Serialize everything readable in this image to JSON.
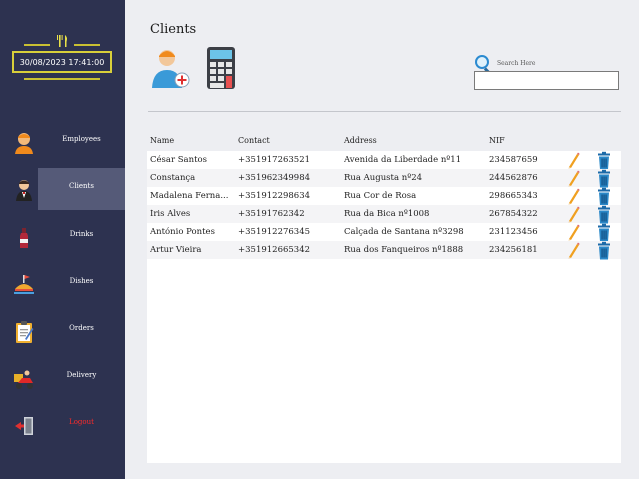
{
  "sidebar": {
    "clock": "30/08/2023 17:41:00",
    "items": [
      {
        "label": "Employees",
        "icon": "employee-icon"
      },
      {
        "label": "Clients",
        "icon": "waiter-icon"
      },
      {
        "label": "Drinks",
        "icon": "bottle-icon"
      },
      {
        "label": "Dishes",
        "icon": "dish-icon"
      },
      {
        "label": "Orders",
        "icon": "clipboard-icon"
      },
      {
        "label": "Delivery",
        "icon": "scooter-icon"
      },
      {
        "label": "Logout",
        "icon": "door-icon"
      }
    ]
  },
  "main": {
    "title": "Clients",
    "search": {
      "label": "Search Here",
      "value": ""
    },
    "table": {
      "headers": [
        "Name",
        "Contact",
        "Address",
        "NIF"
      ],
      "rows": [
        [
          "César Santos",
          "+351917263521",
          "Avenida da Liberdade nº11",
          "234587659"
        ],
        [
          "Constança",
          "+351962349984",
          "Rua Augusta nº24",
          "244562876"
        ],
        [
          "Madalena Ferna...",
          "+351912298634",
          "Rua Cor de Rosa",
          "298665343"
        ],
        [
          "Íris Alves",
          "+35191762342",
          "Rua da Bica nº1008",
          "267854322"
        ],
        [
          "António Pontes",
          "+351912276345",
          "Calçada de Santana nº3298",
          "231123456"
        ],
        [
          "Artur Vieira",
          "+351912665342",
          "Rua dos Fanqueiros nº1888",
          "234256181"
        ]
      ]
    }
  }
}
